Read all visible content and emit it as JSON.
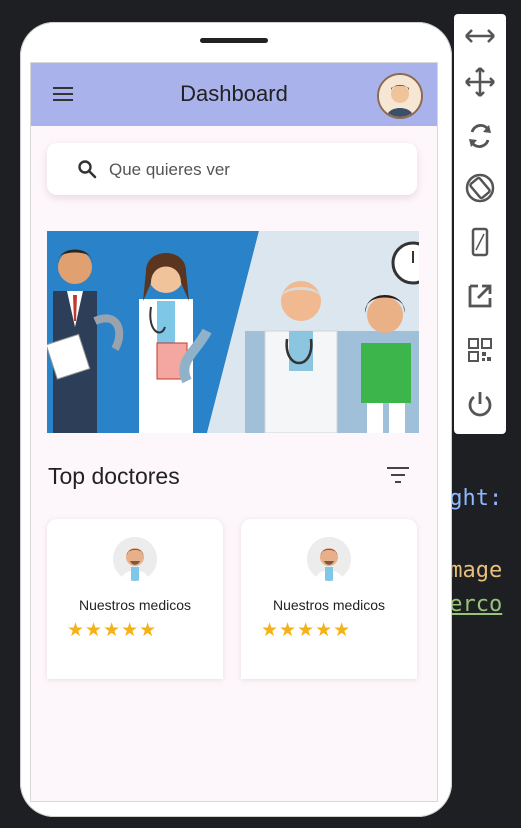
{
  "app": {
    "title": "Dashboard",
    "search": {
      "placeholder": "Que quieres ver"
    },
    "section_title": "Top doctores",
    "doctors": [
      {
        "name": "Nuestros medicos",
        "rating_stars": "★★★★★",
        "rating": 5
      },
      {
        "name": "Nuestros medicos",
        "rating_stars": "★★★★★",
        "rating": 5
      }
    ]
  },
  "editor_background": {
    "lines": [
      "ight:",
      "Image",
      "serco"
    ]
  },
  "toolbar": {
    "icons": [
      "resize-horizontal-icon",
      "move-icon",
      "rotate-icon",
      "rotate-screen-icon",
      "phone-icon",
      "open-external-icon",
      "qr-code-icon",
      "power-icon"
    ]
  },
  "colors": {
    "appbar": "#a9b2ea",
    "screen_bg": "#fdf7fb",
    "star": "#f3b21b",
    "banner_blue": "#2a83c9"
  }
}
